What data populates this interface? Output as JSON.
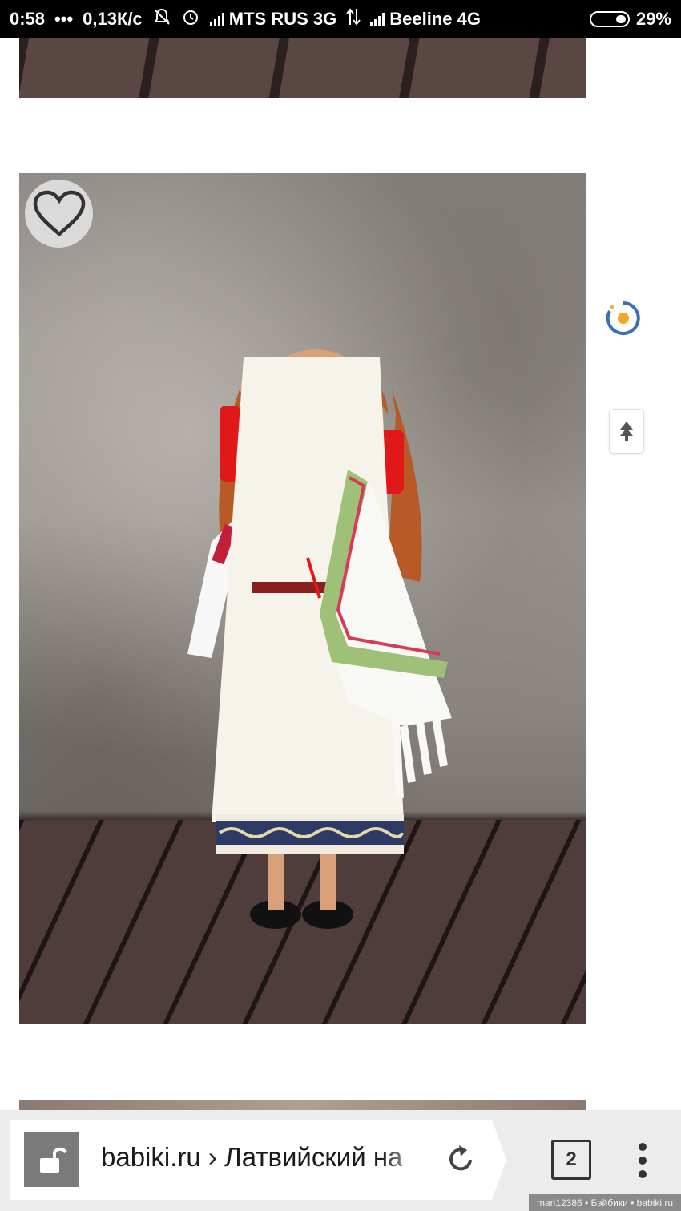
{
  "status_bar": {
    "time": "0:58",
    "dots": "•••",
    "speed": "0,13К/с",
    "carrier1": "MTS RUS 3G",
    "carrier2": "Beeline 4G",
    "battery": "29%",
    "icons": [
      "mute-icon",
      "alarm-icon",
      "signal-icon",
      "data-arrows-icon",
      "battery-icon"
    ]
  },
  "photos": {
    "main": "doll-photo"
  },
  "browser": {
    "url_text": "babiki.ru › Латвийский на",
    "tab_count": "2",
    "icons": [
      "lock-open-icon",
      "reload-icon",
      "tabs-icon",
      "menu-dots-icon"
    ]
  },
  "floating": {
    "icons": [
      "heart-icon",
      "loader-icon",
      "scroll-top-icon"
    ]
  },
  "watermark": "mari12386 • Бэйбики • babiki.ru",
  "colors": {
    "status_bg": "#000000",
    "browser_bar_bg": "#ececec",
    "accent_orange": "#f5a623"
  }
}
